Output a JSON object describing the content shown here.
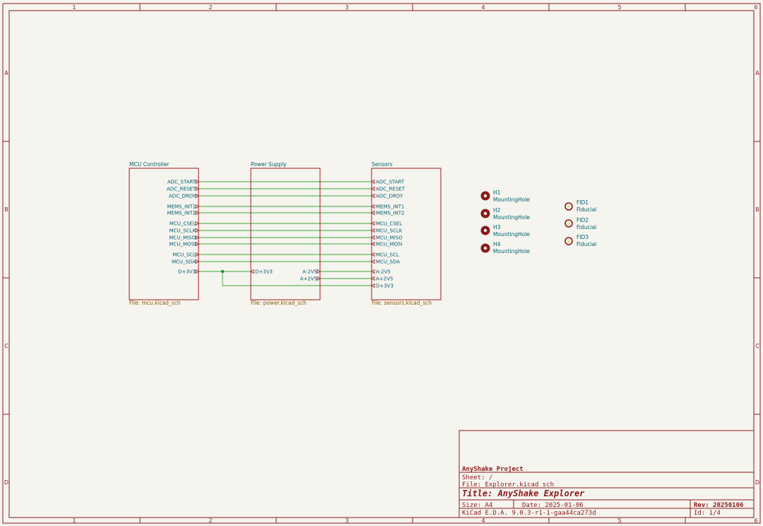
{
  "frame": {
    "columns": [
      "1",
      "2",
      "3",
      "4",
      "5",
      "6"
    ],
    "rows": [
      "A",
      "B",
      "C",
      "D"
    ]
  },
  "sheets": {
    "mcu": {
      "name": "MCU Controller",
      "file": "File: mcu.kicad_sch",
      "pins": [
        "ADC_START",
        "ADC_RESET",
        "ADC_DRDY",
        "MEMS_INT1",
        "MEMS_INT2",
        "MCU_CSEL",
        "MCU_SCLK",
        "MCU_MISO",
        "MCU_MOSI",
        "MCU_SCL",
        "MCU_SDA",
        "D+3V3"
      ]
    },
    "power": {
      "name": "Power Supply",
      "file": "File: power.kicad_sch",
      "pins_left": [
        "D+3V3"
      ],
      "pins_right": [
        "A-2V5",
        "A+2V5"
      ]
    },
    "sensors": {
      "name": "Sensors",
      "file": "File: sensors.kicad_sch",
      "pins": [
        "ADC_START",
        "ADC_RESET",
        "ADC_DRDY",
        "MEMS_INT1",
        "MEMS_INT2",
        "MCU_CSEL",
        "MCU_SCLK",
        "MCU_MISO",
        "MCU_MOSI",
        "MCU_SCL",
        "MCU_SDA",
        "A-2V5",
        "A+2V5",
        "D+3V3"
      ]
    }
  },
  "mounting_holes": [
    {
      "ref": "H1",
      "value": "MountingHole"
    },
    {
      "ref": "H2",
      "value": "MountingHole"
    },
    {
      "ref": "H3",
      "value": "MountingHole"
    },
    {
      "ref": "H4",
      "value": "MountingHole"
    }
  ],
  "fiducials": [
    {
      "ref": "FID1",
      "value": "Fiducial"
    },
    {
      "ref": "FID2",
      "value": "Fiducial"
    },
    {
      "ref": "FID3",
      "value": "Fiducial"
    }
  ],
  "title_block": {
    "company": "AnyShake Project",
    "sheet": "Sheet: /",
    "file": "File: Explorer.kicad_sch",
    "title": "Title: AnyShake Explorer",
    "size": "Size: A4",
    "date": "Date: 2025-01-06",
    "rev": "Rev: 20250106",
    "tool": "KiCad E.D.A. 9.0.3-r1-1-gaa44ca273d",
    "id": "Id: 1/4"
  },
  "colors": {
    "frame": "#8a1a1a",
    "wire": "#3aa63a",
    "label": "#00606e",
    "file": "#8a5a00",
    "hole": "#8a1a1a"
  }
}
